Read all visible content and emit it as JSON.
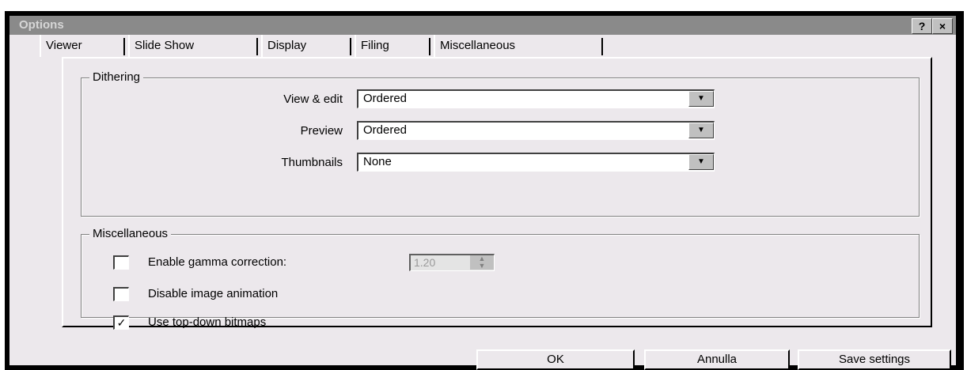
{
  "window": {
    "title": "Options",
    "help_button": "?",
    "close_button": "×"
  },
  "tabs": [
    {
      "label": "Viewer"
    },
    {
      "label": "Slide Show"
    },
    {
      "label": "Display"
    },
    {
      "label": "Filing"
    },
    {
      "label": "Miscellaneous"
    }
  ],
  "active_tab": "Display",
  "dithering": {
    "label": "Dithering",
    "rows": [
      {
        "label": "View & edit",
        "value": "Ordered"
      },
      {
        "label": "Preview",
        "value": "Ordered"
      },
      {
        "label": "Thumbnails",
        "value": "None"
      }
    ]
  },
  "misc": {
    "label": "Miscellaneous",
    "gamma": {
      "label": "Enable gamma correction:",
      "checked": false,
      "value": "1.20"
    },
    "disable_animation": {
      "label": "Disable image animation",
      "checked": false
    },
    "topdown": {
      "label": "Use top-down bitmaps",
      "checked": true,
      "mark": "✓"
    }
  },
  "buttons": {
    "ok": "OK",
    "cancel": "Annulla",
    "save": "Save settings"
  },
  "icons": {
    "dropdown": "▼",
    "spin_up": "▲",
    "spin_down": "▼"
  }
}
